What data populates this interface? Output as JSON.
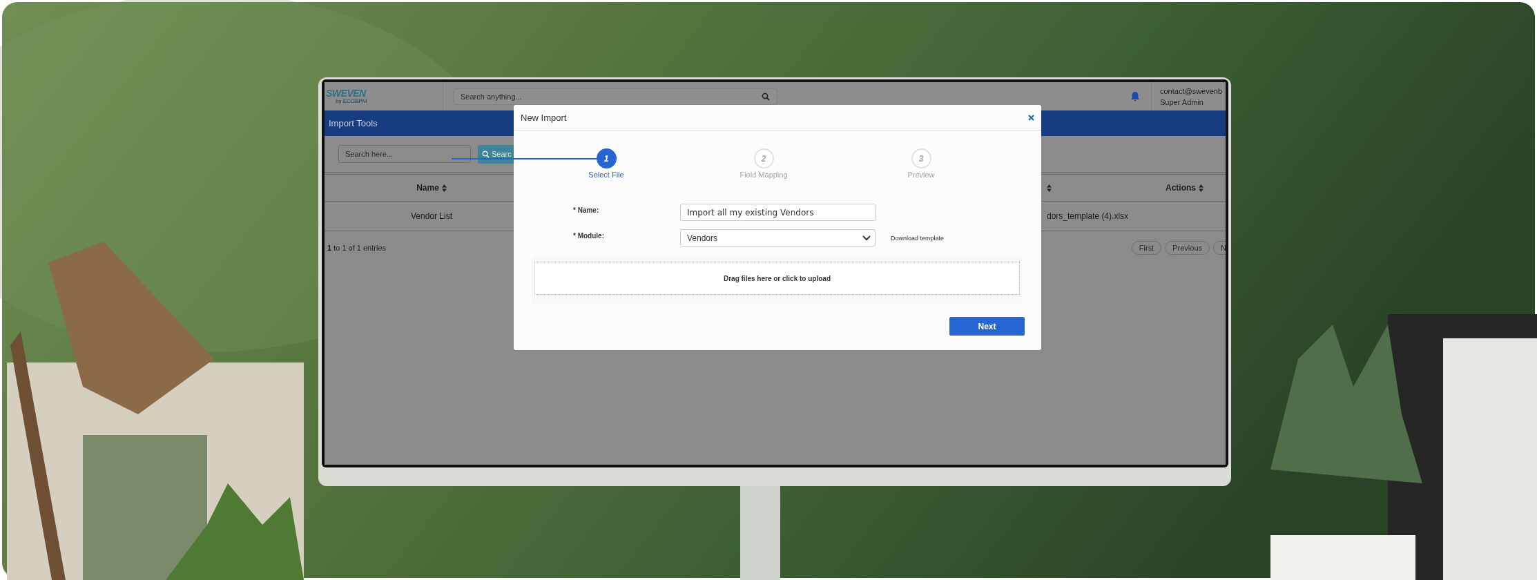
{
  "app": {
    "logo": {
      "name": "SWEVEN",
      "tagline": "by ECOBPM"
    },
    "search": {
      "placeholder": "Search anything..."
    },
    "user": {
      "email": "contact@swevenb",
      "role": "Super Admin"
    }
  },
  "page_header": {
    "title": "Import Tools"
  },
  "toolbar": {
    "search": {
      "placeholder": "Search here..."
    },
    "search_button": "Searc"
  },
  "table": {
    "columns": [
      {
        "label": "Name",
        "sortable": true
      },
      {
        "sortable": true
      },
      {
        "label": "Actions",
        "sortable": true
      }
    ],
    "rows": [
      {
        "cells": [
          "Vendor List",
          "dors_template (4).xlsx"
        ]
      }
    ]
  },
  "pagination": {
    "summary": "**1** to 1 of 1 entries",
    "buttons": [
      "First",
      "Previous",
      "N"
    ]
  },
  "modal": {
    "title": "New Import",
    "steps": [
      {
        "number": "1",
        "label": "Select File",
        "selected": true
      },
      {
        "number": "2",
        "label": "Field Mapping",
        "selected": false
      },
      {
        "number": "3",
        "label": "Preview",
        "selected": false
      }
    ],
    "fields": [
      {
        "kind": "text",
        "label": "* Name:",
        "value": "Import all my existing Vendors"
      },
      {
        "kind": "select",
        "label": "* Module:",
        "value": "Vendors",
        "link": "Download template"
      }
    ],
    "dropzone": "Drag files here or click to upload",
    "next_button": "Next"
  }
}
